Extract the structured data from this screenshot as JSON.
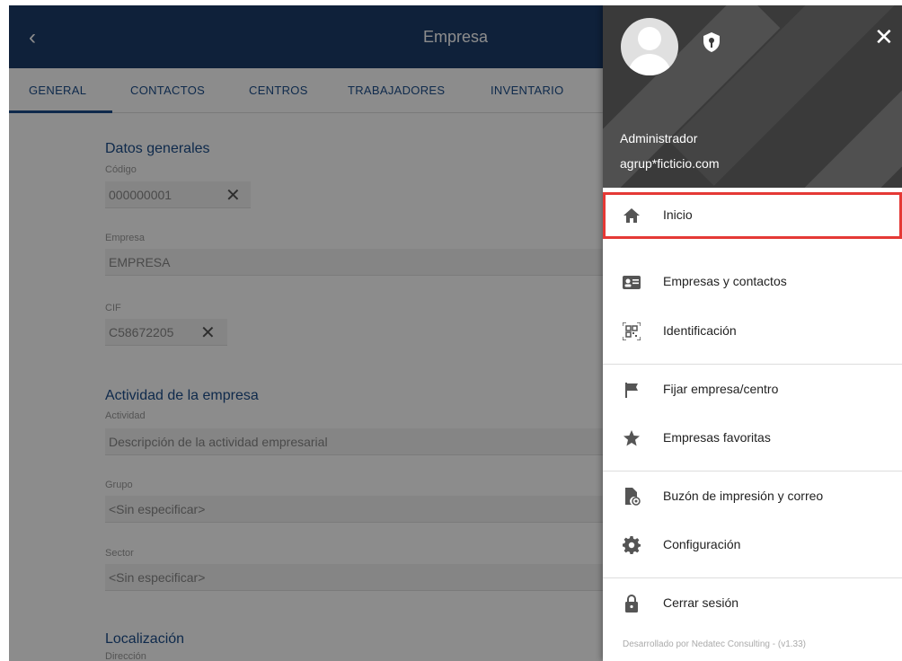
{
  "appbar": {
    "back_icon": "chevron-left-icon",
    "title": "Empresa"
  },
  "tabs": [
    {
      "label": "GENERAL"
    },
    {
      "label": "CONTACTOS"
    },
    {
      "label": "CENTROS"
    },
    {
      "label": "TRABAJADORES"
    },
    {
      "label": "INVENTARIO"
    }
  ],
  "form": {
    "section_general": "Datos generales",
    "codigo_label": "Código",
    "codigo_value": "000000001",
    "empresa_label": "Empresa",
    "empresa_value": "EMPRESA",
    "cif_label": "CIF",
    "cif_value": "C58672205",
    "section_actividad": "Actividad de la empresa",
    "actividad_label": "Actividad",
    "actividad_value": "Descripción de la actividad empresarial",
    "grupo_label": "Grupo",
    "grupo_value": "<Sin especificar>",
    "sector_label": "Sector",
    "sector_value": "<Sin especificar>",
    "section_localizacion": "Localización",
    "direccion_label": "Dirección"
  },
  "drawer": {
    "user_name": "Administrador",
    "user_email": "agrup*ficticio.com",
    "items": [
      {
        "label": "Inicio",
        "icon": "home-icon"
      },
      {
        "label": "Empresas y contactos",
        "icon": "contact-card-icon"
      },
      {
        "label": "Identificación",
        "icon": "qr-code-icon"
      },
      {
        "label": "Fijar empresa/centro",
        "icon": "flag-icon"
      },
      {
        "label": "Empresas favoritas",
        "icon": "star-icon"
      },
      {
        "label": "Buzón de impresión y correo",
        "icon": "print-mail-icon"
      },
      {
        "label": "Configuración",
        "icon": "gear-icon"
      },
      {
        "label": "Cerrar sesión",
        "icon": "lock-icon"
      }
    ],
    "footer": "Desarrollado por Nedatec Consulting - (v1.33)"
  },
  "colors": {
    "appbar": "#1c3d6b",
    "accent": "#1c4e8a",
    "highlight": "#e53935"
  }
}
